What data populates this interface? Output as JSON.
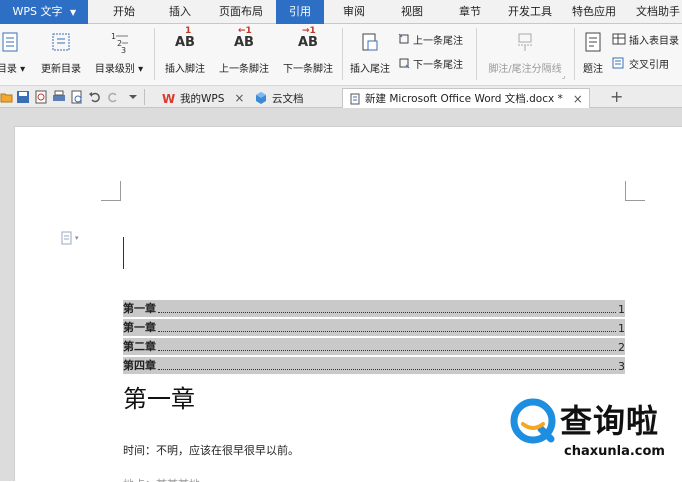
{
  "app": {
    "name": "WPS 文字"
  },
  "menu": {
    "tabs": [
      "开始",
      "插入",
      "页面布局",
      "引用",
      "审阅",
      "视图",
      "章节",
      "开发工具",
      "特色应用",
      "文档助手"
    ],
    "active": "引用"
  },
  "ribbon": {
    "toc": "目录",
    "update_toc": "更新目录",
    "toc_level": "目录级别",
    "insert_footnote": "插入脚注",
    "prev_footnote": "上一条脚注",
    "next_footnote": "下一条脚注",
    "insert_endnote": "插入尾注",
    "prev_endnote": "上一条尾注",
    "next_endnote": "下一条尾注",
    "separator": "脚注/尾注分隔线",
    "caption": "题注",
    "insert_table_toc": "插入表目录",
    "cross_ref": "交叉引用"
  },
  "tabs": {
    "my_wps": "我的WPS",
    "cloud_docs": "云文档",
    "document": "新建 Microsoft Office Word 文档.docx *"
  },
  "document": {
    "toc": [
      {
        "title": "第一章",
        "page": "1"
      },
      {
        "title": "第一章",
        "page": "1"
      },
      {
        "title": "第二章",
        "page": "2"
      },
      {
        "title": "第四章",
        "page": "3"
      }
    ],
    "heading": "第一章",
    "body": "时间：不明，应该在很早很早以前。",
    "body_partial": "地点：某某某地"
  },
  "watermark": {
    "text": "查询啦",
    "url": "chaxunla.com"
  },
  "colors": {
    "accent": "#2d6fc4",
    "toc_highlight": "#c9c9c9",
    "watermark_blue": "#1e8fe0",
    "watermark_orange": "#f5a623"
  }
}
